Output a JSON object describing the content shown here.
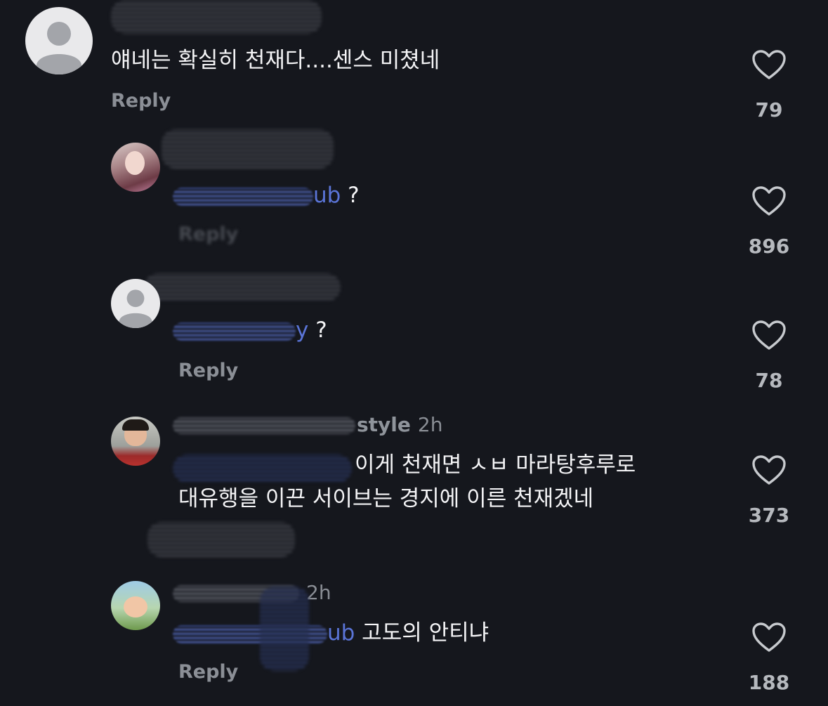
{
  "comments": [
    {
      "username_tail": "",
      "time": "",
      "mention": "",
      "text": "얘네는 확실히 천재다....센스 미쳤네",
      "text2": "",
      "reply": "Reply",
      "likes": "79"
    },
    {
      "username_tail": "",
      "time": "",
      "mention": "ub",
      "text": " ?",
      "text2": "",
      "reply": "Reply",
      "likes": "896"
    },
    {
      "username_tail": "",
      "time": "",
      "mention": "y",
      "text": " ?",
      "text2": "",
      "reply": "Reply",
      "likes": "78"
    },
    {
      "username_tail": "style",
      "time": "2h",
      "mention": "",
      "text": "이게 천재면 ㅅㅂ 마라탕후루로",
      "text2": "대유행을 이끈 서이브는 경지에 이른 천재겠네",
      "reply": "",
      "likes": "373"
    },
    {
      "username_tail": "",
      "time": "2h",
      "mention": "ub",
      "text": " 고도의 안티냐",
      "text2": "",
      "reply": "Reply",
      "likes": "188"
    }
  ],
  "icons": {
    "like": "heart-icon",
    "default_avatar": "default-avatar-icon"
  },
  "colors": {
    "background": "#15171d",
    "mention": "#5a74d6",
    "muted": "#8b8f96"
  }
}
